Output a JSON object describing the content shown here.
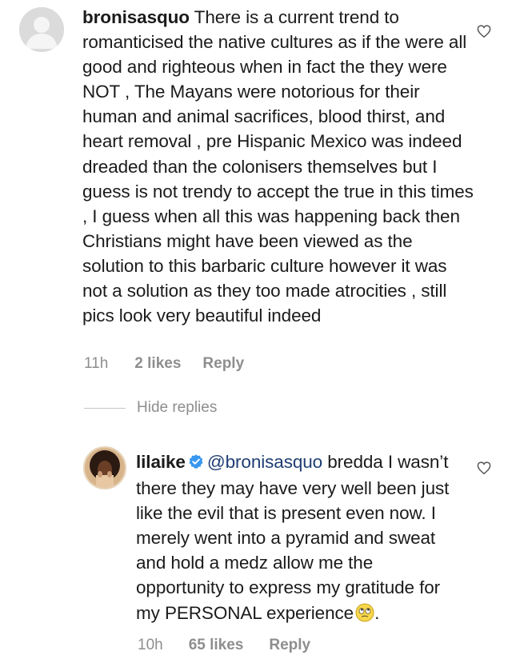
{
  "comments": [
    {
      "username": "bronisasquo",
      "text": "There is a current trend to romanticised the native cultures as if the were all good and righteous when in fact the they were NOT , The Mayans were notorious for their human and animal sacrifices, blood thirst, and heart removal , pre Hispanic Mexico was indeed dreaded than the colonisers themselves but I guess is not trendy to accept the true in this times , I guess when all this was happening back then Christians might have been viewed as the solution to this barbaric culture however it was not a solution as they too made atrocities , still pics look very beautiful indeed",
      "time": "11h",
      "likes": "2 likes",
      "reply": "Reply"
    }
  ],
  "hide_replies": "Hide replies",
  "reply_comment": {
    "username": "lilaike",
    "verified": true,
    "mention": "@bronisasquo",
    "text": "bredda I wasn’t there they may have very well been just like the evil that is present even now. I merely went into a pyramid and sweat and hold a medz allow me the opportunity to express my gratitude for my PERSONAL experience",
    "trailing_punct": ".",
    "emoji": "face-with-rolling-eyes",
    "time": "10h",
    "likes": "65 likes",
    "reply": "Reply"
  },
  "colors": {
    "text": "#1b1b1b",
    "meta": "#8e8e8e",
    "mention": "#1f3e73",
    "verified": "#3897f0"
  }
}
